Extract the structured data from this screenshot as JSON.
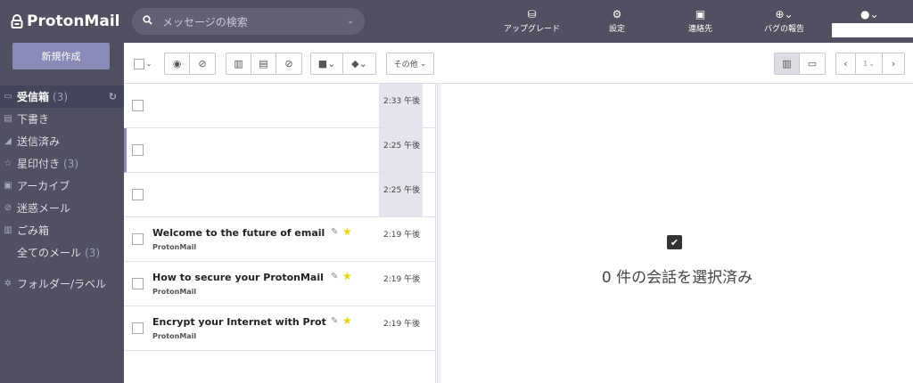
{
  "app": {
    "logo": "ProtonMail"
  },
  "sidebar": {
    "compose_label": "新規作成",
    "items": [
      {
        "label": "受信箱",
        "count": "(3)",
        "icon": "inbox-icon"
      },
      {
        "label": "下書き",
        "count": "",
        "icon": "draft-icon"
      },
      {
        "label": "送信済み",
        "count": "",
        "icon": "send-icon"
      },
      {
        "label": "星印付き",
        "count": "(3)",
        "icon": "star-icon"
      },
      {
        "label": "アーカイブ",
        "count": "",
        "icon": "archive-icon"
      },
      {
        "label": "迷惑メール",
        "count": "",
        "icon": "spam-icon"
      },
      {
        "label": "ごみ箱",
        "count": "",
        "icon": "trash-icon"
      },
      {
        "label": "全てのメール",
        "count": "(3)",
        "icon": ""
      },
      {
        "label": "フォルダー/ラベル",
        "count": "",
        "icon": "gear-icon"
      }
    ]
  },
  "topbar": {
    "search_placeholder": "メッセージの検索",
    "nav": [
      {
        "label": "アップグレード",
        "icon": "upgrade-icon"
      },
      {
        "label": "設定",
        "icon": "settings-icon"
      },
      {
        "label": "連絡先",
        "icon": "contacts-icon"
      },
      {
        "label": "バグの報告",
        "icon": "bug-icon"
      }
    ]
  },
  "toolbar": {
    "more_label": "その他",
    "page_label": "1"
  },
  "messages": [
    {
      "subject": "",
      "sender": "",
      "time": "2:33 午後",
      "attachment": false,
      "starred": false,
      "shaded": true
    },
    {
      "subject": "",
      "sender": "",
      "time": "2:25 午後",
      "attachment": false,
      "starred": false,
      "shaded": true
    },
    {
      "subject": "",
      "sender": "",
      "time": "2:25 午後",
      "attachment": false,
      "starred": false,
      "shaded": true
    },
    {
      "subject": "Welcome to the future of email",
      "sender": "ProtonMail",
      "time": "2:19 午後",
      "attachment": true,
      "starred": true,
      "shaded": false
    },
    {
      "subject": "How to secure your ProtonMail ac…",
      "sender": "ProtonMail",
      "time": "2:19 午後",
      "attachment": true,
      "starred": true,
      "shaded": false
    },
    {
      "subject": "Encrypt your Internet with Proton…",
      "sender": "ProtonMail",
      "time": "2:19 午後",
      "attachment": true,
      "starred": true,
      "shaded": false
    }
  ],
  "pane": {
    "selected_text": "0 件の会話を選択済み"
  },
  "colors": {
    "sidebar": "#505061",
    "accent": "#8a8ab8",
    "star": "#e8d400"
  }
}
